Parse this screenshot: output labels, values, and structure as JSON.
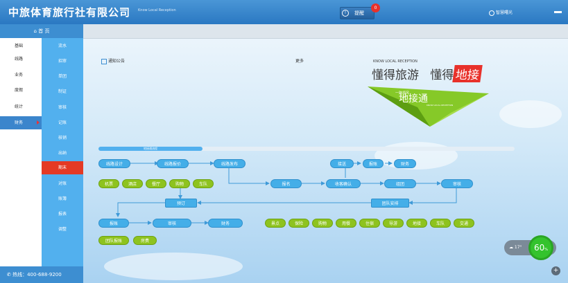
{
  "header": {
    "company": "中旅体育旅行社有限公司",
    "tagline": "Know Local Reception",
    "remind_label": "提醒",
    "remind_count": "0",
    "user": "智慧曙光"
  },
  "sidebar": {
    "home": "首 页",
    "hotline": "热线：400-688-9200",
    "nav": [
      "基础",
      "线路",
      "业务",
      "度假",
      "统计",
      "财务"
    ],
    "sub": [
      "流水",
      "招审",
      "单团",
      "制证",
      "审核",
      "记账",
      "核销",
      "出纳",
      "期末",
      "对账",
      "账簿",
      "报表",
      "调整"
    ]
  },
  "content": {
    "notice_title": "通知公告",
    "more": "更多",
    "brand_en": "KNOW LOCAL RECEPTION",
    "slogan_a": "懂得旅游",
    "slogan_b": "懂得",
    "slogan_hl": "地接",
    "plane_title": "地接通",
    "plane_pre": "一路领风",
    "plane_en": "KNOW LOCAL RECEPTION",
    "progress_label": "地接通流程"
  },
  "flow": {
    "top": [
      "线路设计",
      "线路报价",
      "线路发布",
      "接送",
      "报账",
      "财务"
    ],
    "mid": [
      "报名",
      "收客确认",
      "组团",
      "审核"
    ],
    "res": [
      "机票",
      "酒店",
      "餐厅",
      "购物",
      "车队"
    ],
    "order": "预订",
    "group": "团队安排",
    "bottom": [
      "报账",
      "审核",
      "财务"
    ],
    "arr": [
      "景点",
      "保险",
      "购物",
      "用餐",
      "住宿",
      "导游",
      "地接",
      "车队",
      "交通"
    ],
    "extra": [
      "团队报账",
      "房费"
    ]
  },
  "weather": {
    "temp": "17°",
    "percent": "60",
    "unit": "%"
  },
  "colors": {
    "header": "#2a78c2",
    "sidebar": "#52b0ee",
    "active": "#e43a25",
    "blue_pill": "#44aee8",
    "green_pill": "#8ec31f"
  }
}
